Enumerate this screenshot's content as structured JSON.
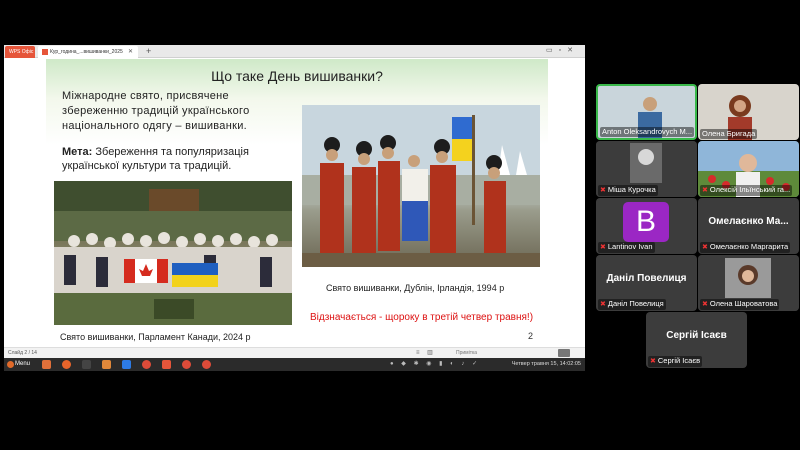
{
  "app": {
    "tabs": [
      {
        "label": "WPS Офіс"
      },
      {
        "label": "Кур_година_...вишиванки_2025"
      }
    ],
    "tab_add_label": "+"
  },
  "slide": {
    "title": "Що таке День вишиванки?",
    "intro": "Міжнародне свято, присвячене збереженню традицій українського національного одягу – вишиванки.",
    "goal_label": "Мета:",
    "goal_text": " Збереження та популяризація української культури та традицій.",
    "caption_canada": "Свято вишиванки, Парламент Канади, 2024 р",
    "caption_dublin": "Свято вишиванки, Дублін, Ірландія, 1994 р",
    "caption_date": "Відзначається - щороку в третій четвер травня!)",
    "number": "2"
  },
  "statusbar": {
    "slide_counter": "Слайд 2 / 14",
    "notes_label": "Примітка"
  },
  "taskbar": {
    "menu_label": "Menu",
    "clock": "Четвер травня 15, 14:02:05"
  },
  "participants": [
    {
      "name": "Anton Oleksandrovych M...",
      "muted": false,
      "active": true
    },
    {
      "name": "Олена Бригада",
      "muted": false,
      "active": false
    },
    {
      "name": "Міша Курочка",
      "muted": true,
      "active": false
    },
    {
      "name": "Олексій Ільїнський га...",
      "muted": true,
      "active": false
    },
    {
      "name": "Lantinov Ivan",
      "muted": true,
      "active": false,
      "avatar_letter": "B",
      "avatar_color": "#9b27c4"
    },
    {
      "name": "Омелаєнко Маргарита",
      "muted": true,
      "active": false,
      "display": "Омелаєнко Ма..."
    },
    {
      "name": "Даніл Повелиця",
      "muted": true,
      "active": false,
      "display": "Даніл Повелиця"
    },
    {
      "name": "Олена Шароватова",
      "muted": true,
      "active": false
    },
    {
      "name": "Сергій Ісаєв",
      "muted": true,
      "active": false,
      "display": "Сергій Ісаєв"
    }
  ],
  "colors": {
    "active_border": "#39b84a",
    "muted_icon": "#e33333",
    "date_caption": "#dd1111"
  }
}
